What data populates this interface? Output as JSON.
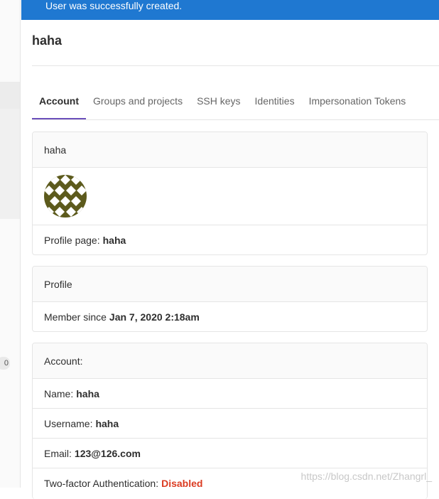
{
  "flash": {
    "message": "User was successfully created."
  },
  "page": {
    "title": "haha"
  },
  "tabs": [
    {
      "label": "Account",
      "active": true
    },
    {
      "label": "Groups and projects",
      "active": false
    },
    {
      "label": "SSH keys",
      "active": false
    },
    {
      "label": "Identities",
      "active": false
    },
    {
      "label": "Impersonation Tokens",
      "active": false
    }
  ],
  "user_card": {
    "header": "haha",
    "profile_page_label": "Profile page:",
    "profile_page_value": "haha"
  },
  "profile_card": {
    "header": "Profile",
    "member_since_label": "Member since",
    "member_since_value": "Jan 7, 2020 2:18am"
  },
  "account_card": {
    "header": "Account:",
    "name_label": "Name:",
    "name_value": "haha",
    "username_label": "Username:",
    "username_value": "haha",
    "email_label": "Email:",
    "email_value": "123@126.com",
    "twofa_label": "Two-factor Authentication:",
    "twofa_value": "Disabled"
  },
  "sidebar": {
    "badge_count": "0"
  },
  "watermark": "https://blog.csdn.net/Zhangrl_",
  "colors": {
    "flash_bg": "#1f78d1",
    "tab_active_underline": "#6b4fbb",
    "danger": "#db3b21",
    "avatar": "#5c5a1c"
  }
}
